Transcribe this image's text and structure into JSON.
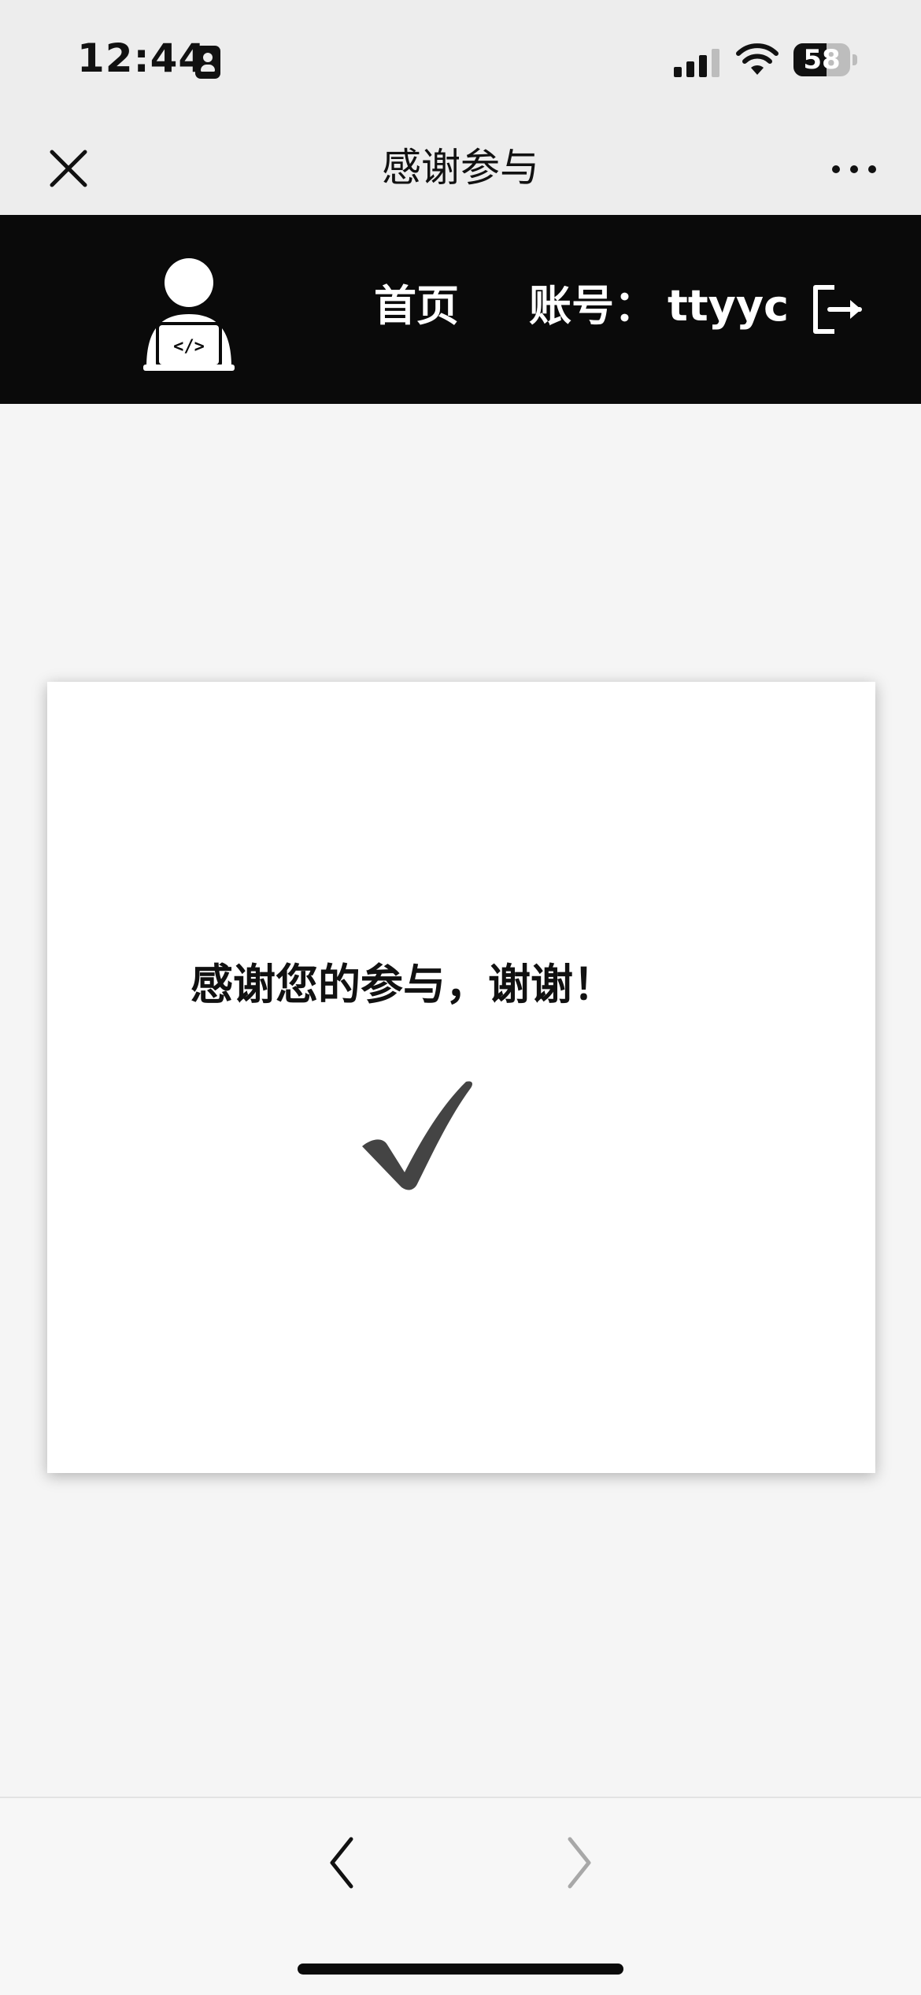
{
  "status_bar": {
    "time": "12:44",
    "battery_level": "58"
  },
  "webview": {
    "title": "感谢参与",
    "close_icon": "close-icon",
    "more_icon": "more-dots-icon"
  },
  "header": {
    "nav_home": "首页",
    "account_label": "账号：",
    "account_name": "ttyyc",
    "avatar_icon": "developer-avatar-icon",
    "logout_icon": "logout-icon"
  },
  "card": {
    "message": "感谢您的参与，谢谢！",
    "check_icon": "check-icon"
  },
  "bottom_nav": {
    "back_icon": "chevron-left-icon",
    "forward_icon": "chevron-right-icon"
  },
  "colors": {
    "header_bg": "#0a0a0a",
    "bar_bg": "#ededed",
    "page_bg": "#f5f5f5",
    "card_bg": "#ffffff",
    "check_color": "#444444"
  }
}
